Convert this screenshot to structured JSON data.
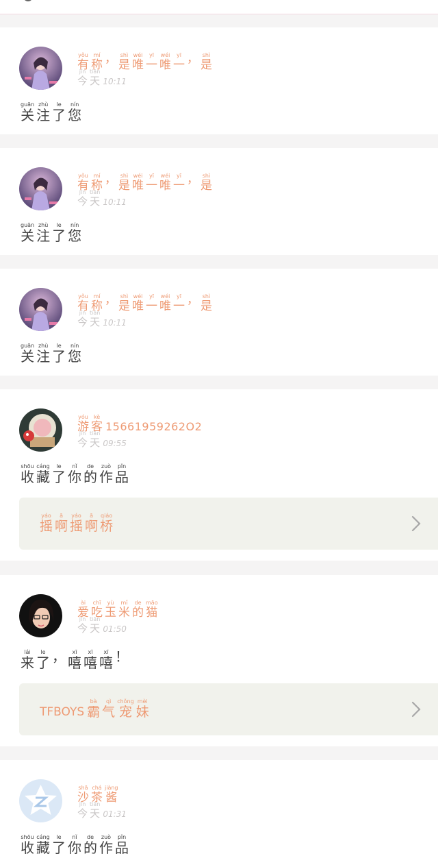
{
  "notifications": [
    {
      "avatar": "anime-girl-avatar",
      "nickname": [
        [
          "有",
          "yǒu"
        ],
        [
          "称",
          "mí"
        ],
        [
          "，",
          ""
        ],
        [
          "是",
          "shì"
        ],
        [
          "唯",
          "wéi"
        ],
        [
          "一",
          "yī"
        ],
        [
          "唯",
          "wéi"
        ],
        [
          "一",
          "yī"
        ],
        [
          "，",
          ""
        ],
        [
          "是",
          "shì"
        ]
      ],
      "nickname_plain": "",
      "day": [
        [
          "今",
          "jīn"
        ],
        [
          "天",
          "tiān"
        ]
      ],
      "time": "10:11",
      "message": [
        [
          "关",
          "guān"
        ],
        [
          "注",
          "zhù"
        ],
        [
          "了",
          "le"
        ],
        [
          "您",
          "nín"
        ]
      ],
      "work": null
    },
    {
      "avatar": "anime-girl-avatar",
      "nickname": [
        [
          "有",
          "yǒu"
        ],
        [
          "称",
          "mí"
        ],
        [
          "，",
          ""
        ],
        [
          "是",
          "shì"
        ],
        [
          "唯",
          "wéi"
        ],
        [
          "一",
          "yī"
        ],
        [
          "唯",
          "wéi"
        ],
        [
          "一",
          "yī"
        ],
        [
          "，",
          ""
        ],
        [
          "是",
          "shì"
        ]
      ],
      "nickname_plain": "",
      "day": [
        [
          "今",
          "jīn"
        ],
        [
          "天",
          "tiān"
        ]
      ],
      "time": "10:11",
      "message": [
        [
          "关",
          "guān"
        ],
        [
          "注",
          "zhù"
        ],
        [
          "了",
          "le"
        ],
        [
          "您",
          "nín"
        ]
      ],
      "work": null
    },
    {
      "avatar": "anime-girl-avatar",
      "nickname": [
        [
          "有",
          "yǒu"
        ],
        [
          "称",
          "mí"
        ],
        [
          "，",
          ""
        ],
        [
          "是",
          "shì"
        ],
        [
          "唯",
          "wéi"
        ],
        [
          "一",
          "yī"
        ],
        [
          "唯",
          "wéi"
        ],
        [
          "一",
          "yī"
        ],
        [
          "，",
          ""
        ],
        [
          "是",
          "shì"
        ]
      ],
      "nickname_plain": "",
      "day": [
        [
          "今",
          "jīn"
        ],
        [
          "天",
          "tiān"
        ]
      ],
      "time": "10:11",
      "message": [
        [
          "关",
          "guān"
        ],
        [
          "注",
          "zhù"
        ],
        [
          "了",
          "le"
        ],
        [
          "您",
          "nín"
        ]
      ],
      "work": null
    },
    {
      "avatar": "fishbowl-avatar",
      "nickname": [
        [
          "游",
          "yóu"
        ],
        [
          "客",
          "kè"
        ]
      ],
      "nickname_plain": "15661959262O2",
      "day": [
        [
          "今",
          "jīn"
        ],
        [
          "天",
          "tiān"
        ]
      ],
      "time": "09:55",
      "message": [
        [
          "收",
          "shōu"
        ],
        [
          "藏",
          "cáng"
        ],
        [
          "了",
          "le"
        ],
        [
          "你",
          "nǐ"
        ],
        [
          "的",
          "de"
        ],
        [
          "作",
          "zuò"
        ],
        [
          "品",
          "pǐn"
        ]
      ],
      "work": {
        "plain": "",
        "title": [
          [
            "摇",
            "yáo"
          ],
          [
            "啊",
            "ā"
          ],
          [
            "摇",
            "yáo"
          ],
          [
            "啊",
            "ā"
          ],
          [
            "桥",
            "qiáo"
          ]
        ]
      }
    },
    {
      "avatar": "glasses-girl-avatar",
      "nickname": [
        [
          "爱",
          "ài"
        ],
        [
          "吃",
          "chī"
        ],
        [
          "玉",
          "yù"
        ],
        [
          "米",
          "mǐ"
        ],
        [
          "的",
          "de"
        ],
        [
          "猫",
          "māo"
        ]
      ],
      "nickname_plain": "",
      "day": [
        [
          "今",
          "jīn"
        ],
        [
          "天",
          "tiān"
        ]
      ],
      "time": "01:50",
      "message": [
        [
          "来",
          "lái"
        ],
        [
          "了",
          "le"
        ],
        [
          "，",
          ""
        ],
        [
          "嘻",
          "xī"
        ],
        [
          "嘻",
          "xī"
        ],
        [
          "嘻",
          "xī"
        ],
        [
          "！",
          ""
        ]
      ],
      "work": {
        "plain": "TFBOYS",
        "title": [
          [
            "霸",
            "bà"
          ],
          [
            "气",
            "qì"
          ],
          [
            "宠",
            "chǒng"
          ],
          [
            "妹",
            "mèi"
          ]
        ]
      }
    },
    {
      "avatar": "qq-default-avatar",
      "nickname": [
        [
          "沙",
          "shā"
        ],
        [
          "茶",
          "chá"
        ],
        [
          "酱",
          "jiàng"
        ]
      ],
      "nickname_plain": "",
      "day": [
        [
          "今",
          "jīn"
        ],
        [
          "天",
          "tiān"
        ]
      ],
      "time": "01:31",
      "message": [
        [
          "收",
          "shōu"
        ],
        [
          "藏",
          "cáng"
        ],
        [
          "了",
          "le"
        ],
        [
          "你",
          "nǐ"
        ],
        [
          "的",
          "de"
        ],
        [
          "作",
          "zuò"
        ],
        [
          "品",
          "pǐn"
        ]
      ],
      "work": null
    }
  ],
  "colors": {
    "accent": "#ee9a73",
    "muted": "#c9c6c6",
    "text": "#444444",
    "work_bg": "#f1f2ec",
    "page_bg": "#f5f4f4"
  }
}
